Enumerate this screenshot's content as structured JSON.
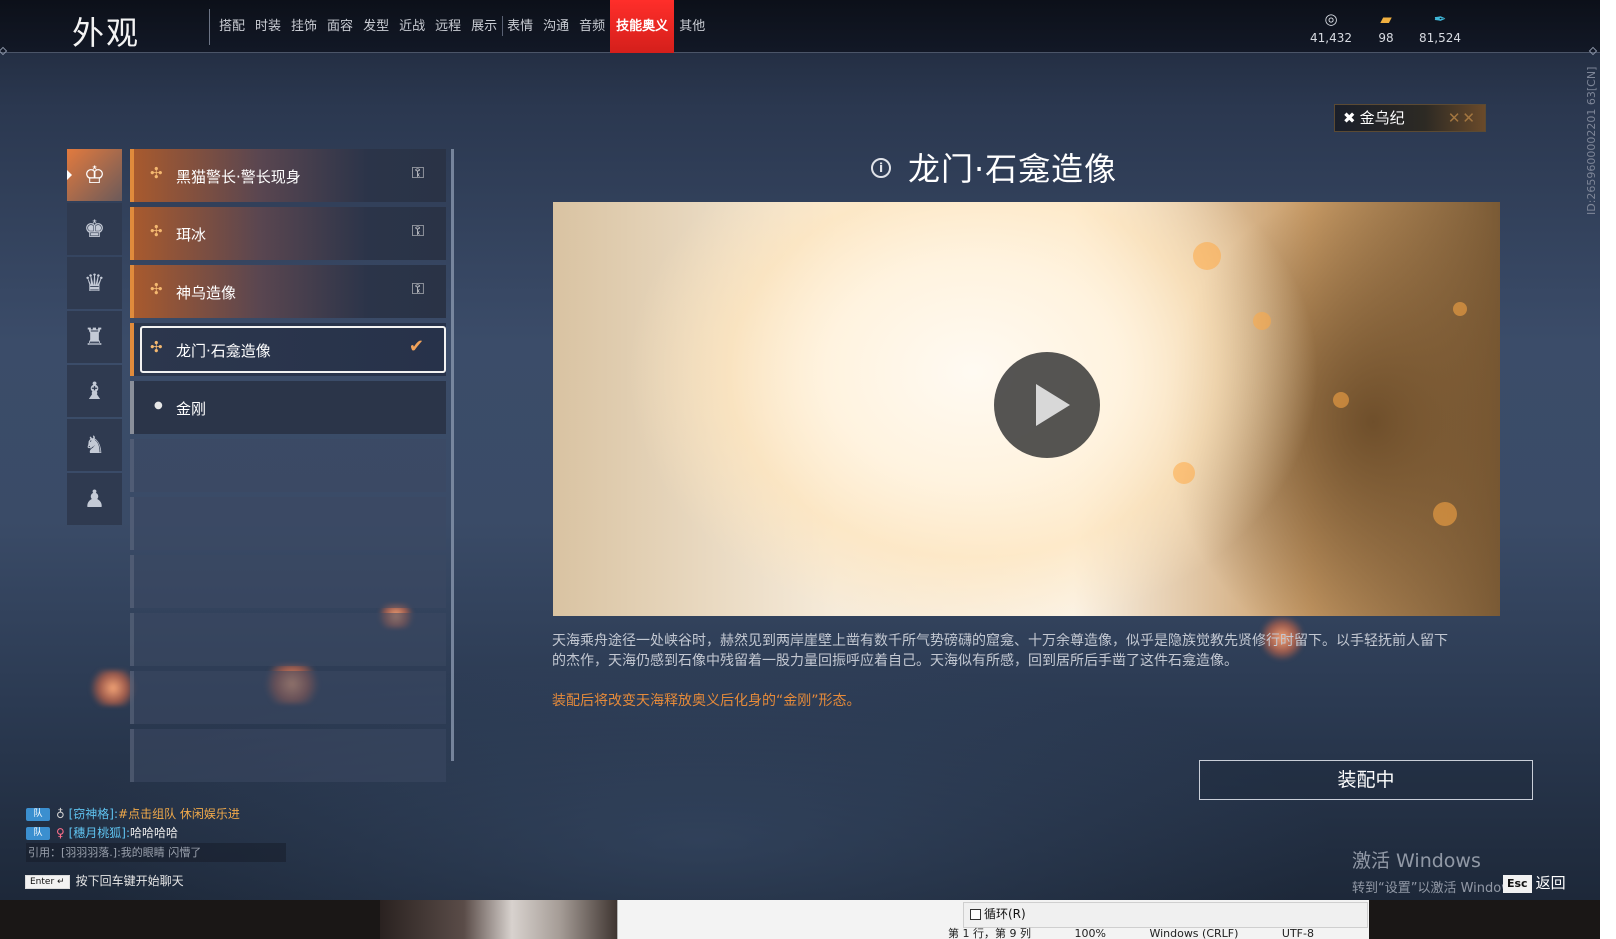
{
  "header": {
    "title": "外观",
    "tabs": [
      {
        "label": "搭配",
        "active": false
      },
      {
        "label": "时装",
        "active": false
      },
      {
        "label": "挂饰",
        "active": false
      },
      {
        "label": "面容",
        "active": false
      },
      {
        "label": "发型",
        "active": false
      },
      {
        "label": "近战",
        "active": false
      },
      {
        "label": "远程",
        "active": false
      },
      {
        "label": "展示",
        "active": false
      },
      {
        "label": "表情",
        "active": false
      },
      {
        "label": "沟通",
        "active": false
      },
      {
        "label": "音频",
        "active": false
      },
      {
        "label": "技能奥义",
        "active": true
      },
      {
        "label": "其他",
        "active": false
      }
    ],
    "currencies": [
      {
        "icon": "coin-icon",
        "glyph": "◎",
        "value": "41,432",
        "color": "#d9dde4"
      },
      {
        "icon": "ticket-icon",
        "glyph": "▰",
        "value": "98",
        "color": "#f0b040"
      },
      {
        "icon": "feather-icon",
        "glyph": "✒",
        "value": "81,524",
        "color": "#3fb7d8"
      }
    ]
  },
  "badge": {
    "label": "金乌纪",
    "icon": "crossed-swords-icon"
  },
  "side_id": "ID:2659600002201 63[CN]",
  "rail": [
    {
      "icon": "avatar-pose-icon",
      "glyph": "♔",
      "active": true
    },
    {
      "icon": "avatar-pose-2-icon",
      "glyph": "♚",
      "active": false
    },
    {
      "icon": "avatar-pose-3-icon",
      "glyph": "♛",
      "active": false
    },
    {
      "icon": "statue-icon",
      "glyph": "♜",
      "active": false
    },
    {
      "icon": "statue-2-icon",
      "glyph": "♝",
      "active": false
    },
    {
      "icon": "statue-3-icon",
      "glyph": "♞",
      "active": false
    },
    {
      "icon": "statue-4-icon",
      "glyph": "♟",
      "active": false
    }
  ],
  "skills": [
    {
      "label": "黑猫警长·警长现身",
      "state": "locked"
    },
    {
      "label": "珥冰",
      "state": "locked"
    },
    {
      "label": "神乌造像",
      "state": "locked"
    },
    {
      "label": "龙门·石龛造像",
      "state": "selected"
    },
    {
      "label": "金刚",
      "state": "default"
    }
  ],
  "detail": {
    "title": "龙门·石龛造像",
    "description": "天海乘舟途径一处峡谷时，赫然见到两岸崖壁上凿有数千所气势磅礴的窟龛、十万余尊造像，似乎是隐族觉教先贤修行时留下。以手轻抚前人留下的杰作，天海仍感到石像中残留着一股力量回振呼应着自己。天海似有所感，回到居所后手凿了这件石龛造像。",
    "note": "装配后将改变天海释放奥义后化身的“金刚”形态。",
    "equip_label": "装配中"
  },
  "chat": {
    "lines": [
      {
        "tag": "队",
        "name": "[窃神格]:",
        "text": "#点击组队 休闲娱乐进",
        "text_color": "#f0a94a"
      },
      {
        "tag": "队",
        "name": "[穗月桃狐]:",
        "text": "哈哈哈哈",
        "text_color": "#e9e9e9"
      }
    ],
    "quote": "引用：[羽羽羽落.]:我的眼睛 闪懵了",
    "hint_key": "Enter ↵",
    "hint": "按下回车键开始聊天"
  },
  "watermark": {
    "line1": "激活 Windows",
    "line2": "转到“设置”以激活 Windows。"
  },
  "back": {
    "key": "Esc",
    "label": "返回"
  },
  "notepad": {
    "loop_label": "循环(R)",
    "status": [
      "第 1 行，第 9 列",
      "100%",
      "Windows (CRLF)",
      "UTF-8"
    ]
  }
}
